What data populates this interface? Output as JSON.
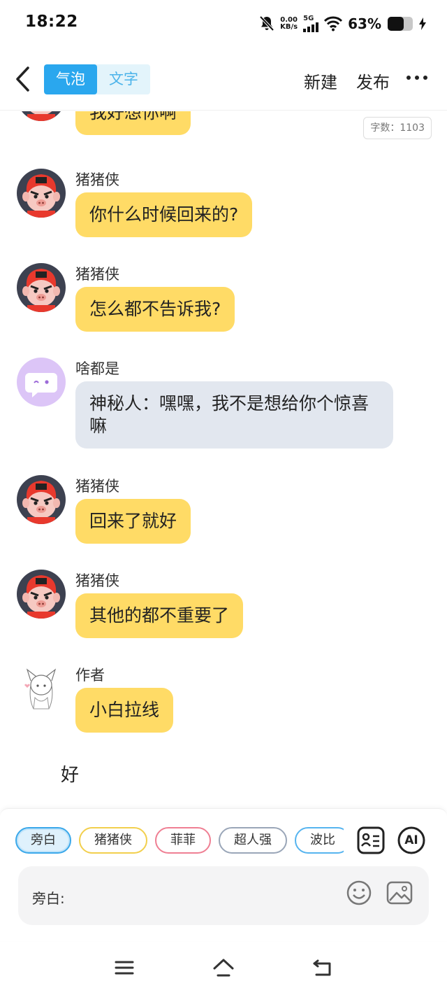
{
  "status_bar": {
    "time": "18:22",
    "net_speed_value": "0.00",
    "net_speed_unit": "KB/s",
    "network_type": "5G",
    "battery_percent": "63%",
    "battery_level": 0.63
  },
  "header": {
    "tab_bubble": "气泡",
    "tab_text": "文字",
    "new_label": "新建",
    "publish_label": "发布"
  },
  "word_count": "字数：1103",
  "colors": {
    "accent": "#2aa7ee",
    "bubble_yellow": "#ffdb66",
    "bubble_gray": "#e2e7ef"
  },
  "messages": [
    {
      "sender": "",
      "text": "我好想你啊",
      "avatar": "pig-hero-avatar",
      "style": "yellow"
    },
    {
      "sender": "猪猪侠",
      "text": "你什么时候回来的?",
      "avatar": "pig-hero-avatar",
      "style": "yellow"
    },
    {
      "sender": "猪猪侠",
      "text": "怎么都不告诉我?",
      "avatar": "pig-hero-avatar",
      "style": "yellow"
    },
    {
      "sender": "啥都是",
      "text": "神秘人：嘿嘿，我不是想给你个惊喜嘛",
      "avatar": "chat-bubble-avatar",
      "style": "gray"
    },
    {
      "sender": "猪猪侠",
      "text": "回来了就好",
      "avatar": "pig-hero-avatar",
      "style": "yellow"
    },
    {
      "sender": "猪猪侠",
      "text": "其他的都不重要了",
      "avatar": "pig-hero-avatar",
      "style": "yellow"
    },
    {
      "sender": "作者",
      "text": "小白拉线",
      "avatar": "anime-girl-avatar",
      "style": "yellow"
    }
  ],
  "narration": "好",
  "characters": [
    "旁白",
    "猪猪侠",
    "菲菲",
    "超人强",
    "波比"
  ],
  "selected_character": "旁白",
  "input": {
    "label": "旁白:"
  },
  "tools": {
    "ai_label": "AI"
  }
}
